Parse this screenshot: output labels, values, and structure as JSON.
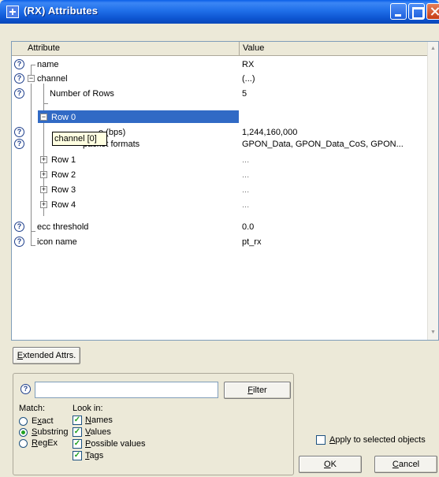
{
  "window": {
    "title": "(RX) Attributes"
  },
  "grid": {
    "col_attribute": "Attribute",
    "col_value": "Value",
    "rows": [
      {
        "label": "name",
        "value": "RX"
      },
      {
        "label": "channel",
        "value": "(...)"
      },
      {
        "label": "Number of Rows",
        "value": "5"
      },
      {
        "label": "Row 0",
        "value": ""
      },
      {
        "label": "e (bps)",
        "value": "1,244,160,000"
      },
      {
        "label": "packet formats",
        "value": "GPON_Data, GPON_Data_CoS, GPON..."
      },
      {
        "label": "Row 1",
        "value": "..."
      },
      {
        "label": "Row 2",
        "value": "..."
      },
      {
        "label": "Row 3",
        "value": "..."
      },
      {
        "label": "Row 4",
        "value": "..."
      },
      {
        "label": "ecc threshold",
        "value": "0.0"
      },
      {
        "label": "icon name",
        "value": "pt_rx"
      }
    ],
    "tooltip": "channel [0]"
  },
  "buttons": {
    "extended_first": "E",
    "extended_rest": "xtended Attrs.",
    "filter_first": "F",
    "filter_rest": "ilter",
    "ok_first": "O",
    "ok_rest": "K",
    "cancel_first": "C",
    "cancel_rest": "ancel"
  },
  "filter": {
    "search_value": "",
    "match_label": "Match:",
    "lookin_label": "Look in:",
    "match_options": [
      {
        "first": "",
        "u": "x",
        "rest": "act",
        "pre": "E",
        "checked": false
      },
      {
        "first": "",
        "u": "S",
        "rest": "ubstring",
        "pre": "",
        "checked": true
      },
      {
        "first": "",
        "u": "R",
        "rest": "egEx",
        "pre": "",
        "checked": false
      }
    ],
    "lookin_options": [
      {
        "u": "N",
        "rest": "ames",
        "checked": true
      },
      {
        "u": "V",
        "rest": "alues",
        "checked": true
      },
      {
        "u": "P",
        "rest": "ossible values",
        "checked": true
      },
      {
        "u": "T",
        "rest": "ags",
        "checked": true
      }
    ],
    "apply_label_u": "A",
    "apply_label_rest": "pply to selected objects",
    "apply_checked": false
  }
}
